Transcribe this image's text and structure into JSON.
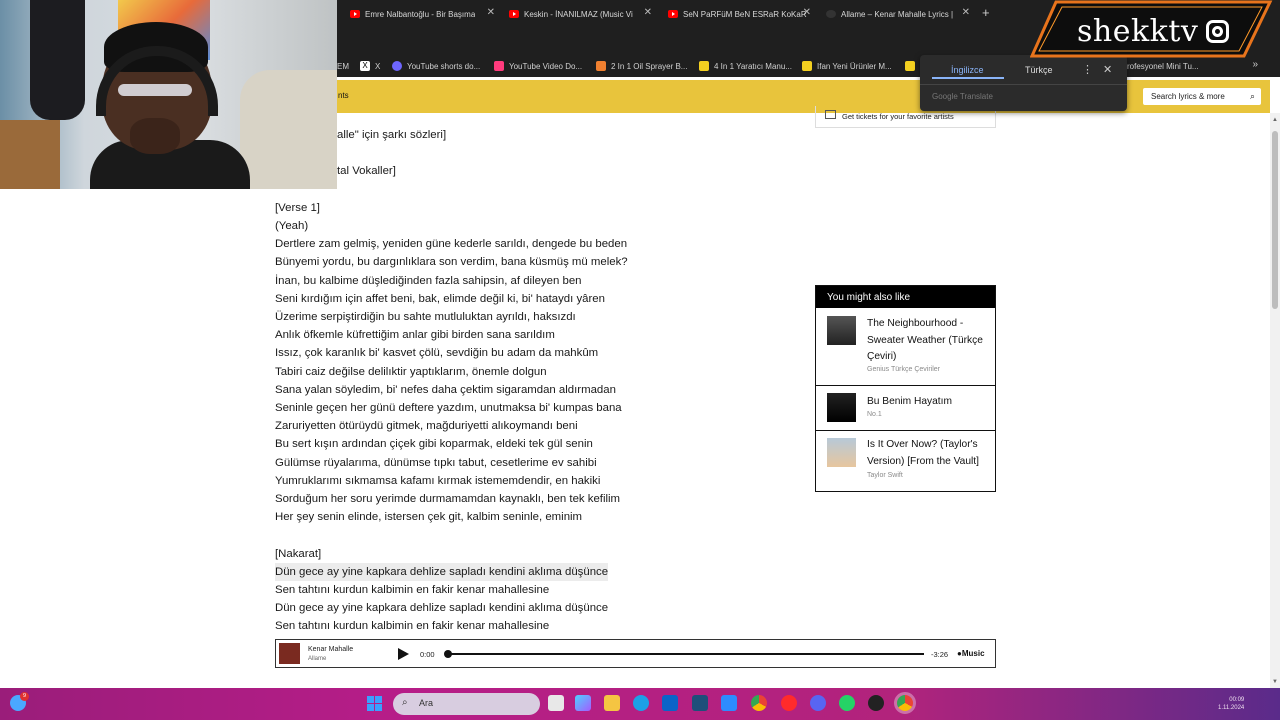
{
  "browser": {
    "tabs": [
      {
        "label": "Emre Nalbantoğlu - Bir Başıma",
        "icon": "youtube-icon"
      },
      {
        "label": "Keskin - İNANILMAZ (Music Vi",
        "icon": "youtube-icon"
      },
      {
        "label": "SeN PaRFüM BeN ESRaR KoKaR",
        "icon": "youtube-icon"
      },
      {
        "label": "Allame – Kenar Mahalle Lyrics |",
        "icon": "genius-icon"
      }
    ],
    "new_tab_label": "+",
    "bookmarks": [
      {
        "label": "EM",
        "color": "#e2e2e2"
      },
      {
        "label": "X",
        "color": "#ffffff"
      },
      {
        "label": "YouTube shorts do...",
        "color": "#6e66ff"
      },
      {
        "label": "YouTube Video Do...",
        "color": "#ff3b7d"
      },
      {
        "label": "2 In 1 Oil Sprayer B...",
        "color": "#f08030"
      },
      {
        "label": "4 In 1 Yaratıcı Manu...",
        "color": "#f4d020"
      },
      {
        "label": "Ifan Yeni Ürünler M...",
        "color": "#f4d020"
      },
      {
        "label": "rofesyonel Mini Tu...",
        "color": "#f4d020"
      }
    ]
  },
  "translate_popup": {
    "source_lang": "İngilizce",
    "target_lang": "Türkçe",
    "brand": "Google Translate"
  },
  "genius": {
    "nav_fragment": "nts",
    "search_placeholder": "Search lyrics & more",
    "tickets_text": "Get tickets for your favorite artists",
    "lyrics_header": "alle\" için şarkı sözleri]",
    "lyrics_header_2": "tal Vokaller]",
    "lyrics": [
      {
        "text": "[Verse 1]"
      },
      {
        "text": "(Yeah)"
      },
      {
        "text": "Dertlere zam gelmiş, yeniden güne kederle sarıldı, dengede bu beden"
      },
      {
        "text": "Bünyemi yordu, bu dargınlıklara son verdim, bana küsmüş mü melek?"
      },
      {
        "text": "İnan, bu kalbime düşlediğinden fazla sahipsin, af dileyen ben"
      },
      {
        "text": "Seni kırdığım için affet beni, bak, elimde değil ki, bi' hataydı yâren"
      },
      {
        "text": "Üzerime serpiştirdiğin bu sahte mutluluktan ayrıldı, haksızdı"
      },
      {
        "text": "Anlık öfkemle küfrettiğim anlar gibi birden sana sarıldım"
      },
      {
        "text": "Issız, çok karanlık bi' kasvet çölü, sevdiğin bu adam da mahkûm"
      },
      {
        "text": "Tabiri caiz değilse delilıktir yaptıklarım, önemle dolgun"
      },
      {
        "text": "Sana yalan söyledim, bi' nefes daha çektim sigaramdan aldırmadan"
      },
      {
        "text": "Seninle geçen her günü deftere yazdım, unutmaksa bi' kumpas bana"
      },
      {
        "text": "Zaruriyetten ötürüydü gitmek, mağduriyetti alıkoymandı beni"
      },
      {
        "text": "Bu sert kışın ardından çiçek gibi koparmak, eldeki tek gül senin"
      },
      {
        "text": "Gülümse rüyalarıma, dünümse tıpkı tabut, cesetlerime ev sahibi"
      },
      {
        "text": "Yumruklarımı sıkmamsa kafamı kırmak istememdendir, en hakiki"
      },
      {
        "text": "Sorduğum her soru yerimde durmamamdan kaynaklı, ben tek kefilim"
      },
      {
        "text": "Her şey senin elinde, istersen çek git, kalbim seninle, eminim"
      }
    ],
    "lyrics_chorus": [
      {
        "text": "[Nakarat]"
      },
      {
        "text": "Dün gece ay yine kapkara dehlize sapladı kendini aklıma düşünce"
      },
      {
        "text": "Sen tahtını kurdun kalbimin en fakir kenar mahallesine"
      },
      {
        "text": "Dün gece ay yine kapkara dehlize sapladı kendini aklıma düşünce"
      },
      {
        "text": "Sen tahtını kurdun kalbimin en fakir kenar mahallesine"
      }
    ],
    "might_also_like": {
      "heading": "You might also like",
      "items": [
        {
          "title": "The Neighbourhood - Sweater Weather (Türkçe Çeviri)",
          "subtitle": "Genius Türkçe Çeviriler"
        },
        {
          "title": "Bu Benim Hayatım",
          "subtitle": "No.1"
        },
        {
          "title": "Is It Over Now? (Taylor's Version) [From the Vault]",
          "subtitle": "Taylor Swift"
        }
      ]
    },
    "player": {
      "title": "Kenar Mahalle",
      "artist": "Allame",
      "elapsed": "0:00",
      "remaining": "-3:26",
      "service": "Music",
      "progress": 0
    }
  },
  "overlay": {
    "logo_text": "shekktv"
  },
  "taskbar": {
    "search_label": "Ara",
    "notification_count": "9",
    "clock_time": "00:09",
    "clock_date": "1.11.2024"
  }
}
